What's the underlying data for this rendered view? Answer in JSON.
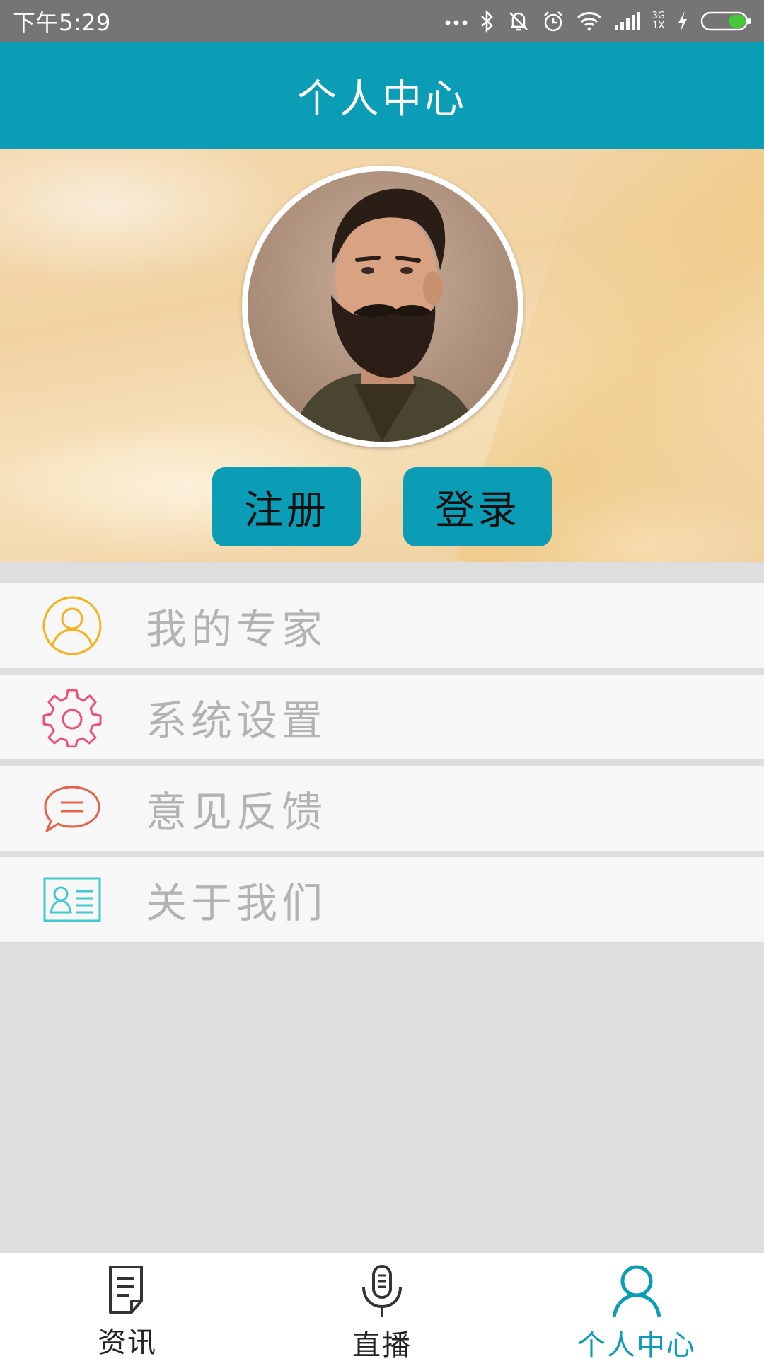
{
  "status_bar": {
    "time": "下午5:29",
    "network_top": "3G",
    "network_bottom": "1X"
  },
  "header": {
    "title": "个人中心"
  },
  "profile": {
    "register_label": "注册",
    "login_label": "登录"
  },
  "menu": {
    "items": [
      {
        "label": "我的专家",
        "icon": "expert-user-icon",
        "color": "#f2b31e"
      },
      {
        "label": "系统设置",
        "icon": "gear-icon",
        "color": "#ef4f73"
      },
      {
        "label": "意见反馈",
        "icon": "feedback-chat-icon",
        "color": "#e8604a"
      },
      {
        "label": "关于我们",
        "icon": "about-id-card-icon",
        "color": "#3fcad0"
      }
    ]
  },
  "bottom_nav": {
    "items": [
      {
        "label": "资讯",
        "icon": "news-document-icon"
      },
      {
        "label": "直播",
        "icon": "microphone-icon"
      },
      {
        "label": "个人中心",
        "icon": "profile-user-icon",
        "active": true
      }
    ]
  },
  "colors": {
    "primary": "#0b9db6",
    "status_bar": "#757575",
    "menu_text": "#b3b3b3",
    "battery": "#47c73a"
  }
}
